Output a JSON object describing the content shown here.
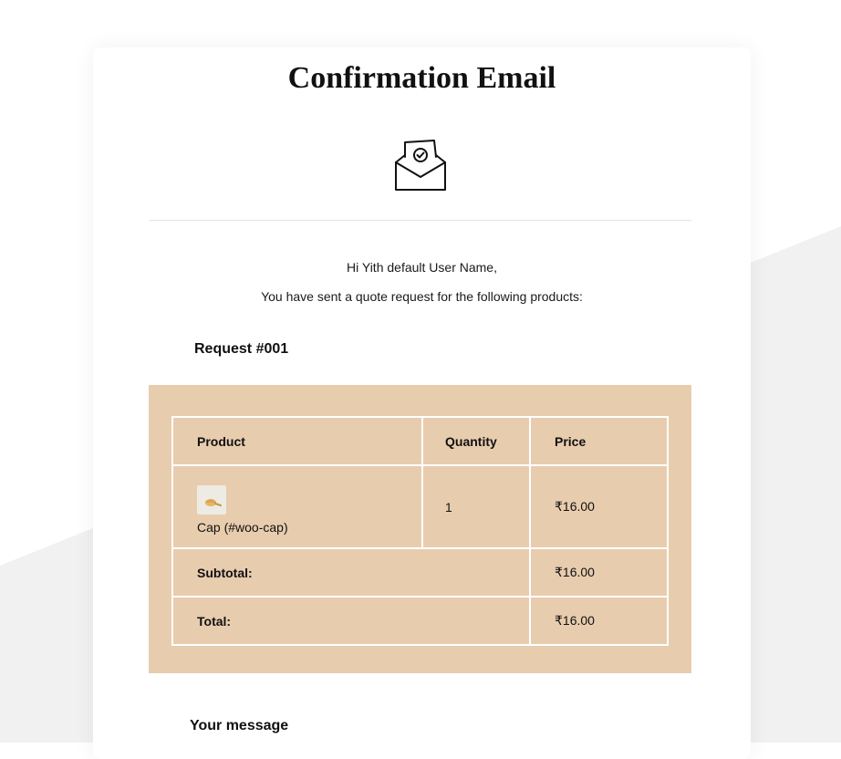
{
  "email": {
    "title": "Confirmation Email",
    "greeting": "Hi Yith default User Name,",
    "intro": "You have sent a quote request for the following products:",
    "request_title": "Request #001",
    "your_message_heading": "Your message"
  },
  "table": {
    "headers": {
      "product": "Product",
      "quantity": "Quantity",
      "price": "Price"
    },
    "items": [
      {
        "product": "Cap (#woo-cap)",
        "quantity": "1",
        "price": "₹16.00"
      }
    ],
    "subtotal_label": "Subtotal:",
    "subtotal_value": "₹16.00",
    "total_label": "Total:",
    "total_value": "₹16.00"
  },
  "colors": {
    "table_background": "#e8ccae",
    "page_background": "#ffffff",
    "background_shape": "#f1f1f1"
  },
  "icons": {
    "header_icon": "envelope-check-icon",
    "product_thumbnail": "cap-thumbnail-icon"
  }
}
